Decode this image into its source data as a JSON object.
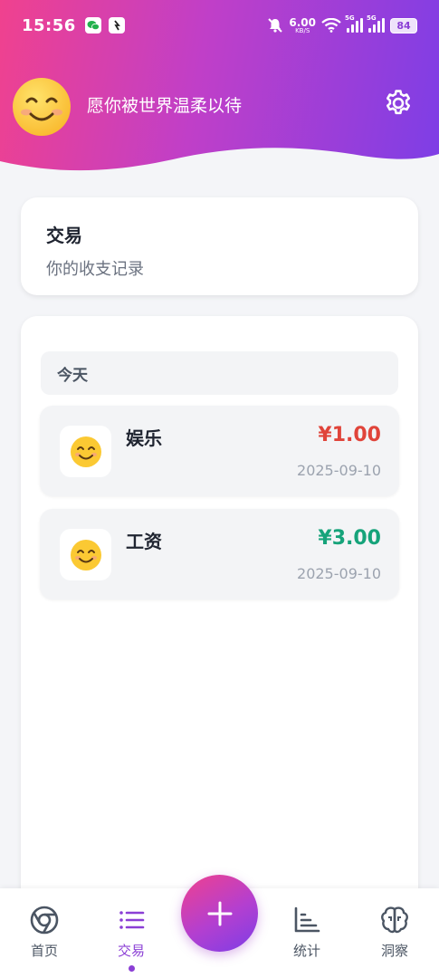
{
  "status_bar": {
    "time": "15:56",
    "net_speed": "6.00",
    "net_unit": "KB/S",
    "signal_label": "5G",
    "battery": "84"
  },
  "header": {
    "greeting": "愿你被世界温柔以待",
    "avatar_icon": "smiley-face-icon",
    "settings_icon": "gear-icon"
  },
  "page_card": {
    "title": "交易",
    "subtitle": "你的收支记录"
  },
  "transactions": {
    "group_label": "今天",
    "items": [
      {
        "category": "娱乐",
        "amount": "¥1.00",
        "date": "2025-09-10",
        "type": "expense",
        "color": "#e0443a"
      },
      {
        "category": "工资",
        "amount": "¥3.00",
        "date": "2025-09-10",
        "type": "income",
        "color": "#16a37a"
      }
    ]
  },
  "bottom_nav": {
    "items": [
      {
        "label": "首页",
        "icon": "home-ring-icon"
      },
      {
        "label": "交易",
        "icon": "list-icon",
        "active": true
      },
      {
        "label": "统计",
        "icon": "bar-chart-icon"
      },
      {
        "label": "洞察",
        "icon": "brain-icon"
      }
    ],
    "fab_icon": "plus-icon"
  },
  "colors": {
    "accent": "#8b3fd5",
    "gradient_start": "#f0418e",
    "gradient_end": "#7d3ee6"
  }
}
